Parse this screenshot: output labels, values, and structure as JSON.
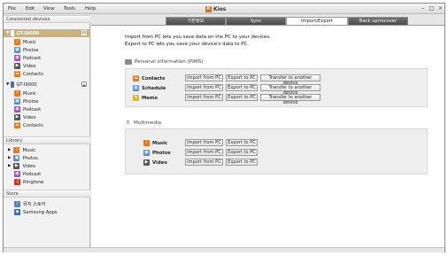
{
  "menu": [
    "File",
    "Edit",
    "View",
    "Tools",
    "Help"
  ],
  "app": {
    "title": "Kies",
    "logo": "K"
  },
  "window_controls": {
    "minimize": "–",
    "maximize": "□",
    "close": "×"
  },
  "sidebar": {
    "connected_header": "Connected devices",
    "devices": [
      {
        "name": "GT-I9000",
        "selected": true,
        "items": [
          "Music",
          "Photos",
          "Podcast",
          "Video",
          "Contacts"
        ]
      },
      {
        "name": "GT-I9000",
        "selected": false,
        "items": [
          "Music",
          "Photos",
          "Podcast",
          "Video",
          "Contacts"
        ]
      }
    ],
    "library_header": "Library",
    "library_items": [
      "Music",
      "Photos",
      "Video",
      "Podcast",
      "Ringtone"
    ],
    "store_header": "Store",
    "store_items": [
      "뮤직 스토어",
      "Samsung Apps"
    ]
  },
  "tabs": [
    "기본정보",
    "Sync",
    "Import/Export",
    "Back up/recover"
  ],
  "active_tab": "Import/Export",
  "main": {
    "intro_line1": "Import from PC lets you save data on the PC to your devices.",
    "intro_line2": "Export to PC lets you save your device's data to PC.",
    "pims_title": "Personal information (PIMS)",
    "pims_rows": [
      {
        "label": "Contacts",
        "import": "Import from PC",
        "export": "Export to PC",
        "transfer": "Transfer to another device"
      },
      {
        "label": "Schedule",
        "import": "Import from PC",
        "export": "Export to PC",
        "transfer": "Transfer to another device"
      },
      {
        "label": "Memo",
        "import": "Import from PC",
        "export": "Export to PC",
        "transfer": "Transfer to another device"
      }
    ],
    "multimedia_title": "Multimedia",
    "multimedia_rows": [
      {
        "label": "Music",
        "import": "Import from PC",
        "export": "Export to PC"
      },
      {
        "label": "Photos",
        "import": "Import from PC",
        "export": "Export to PC"
      },
      {
        "label": "Video",
        "import": "Import from PC",
        "export": "Export to PC"
      }
    ]
  },
  "colors": {
    "selected_device": "#c9b27d",
    "tab_dark": "#5a5a5a",
    "panel": "#eeeeee",
    "brand": "#e06a1a"
  }
}
